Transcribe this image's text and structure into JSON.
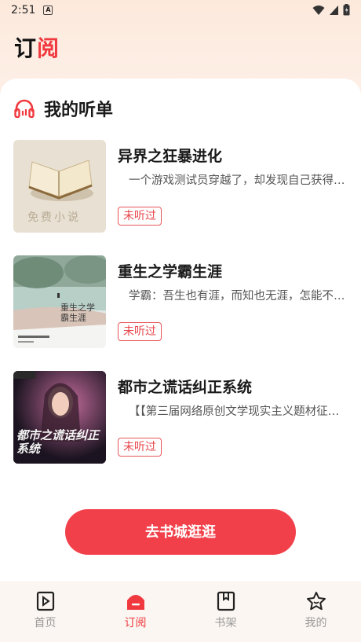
{
  "status_bar": {
    "time": "2:51",
    "notif_icon_letter": "A"
  },
  "page_title": {
    "part1": "订",
    "part2": "阅"
  },
  "section": {
    "title": "我的听单",
    "icon": "headphones-icon"
  },
  "books": [
    {
      "title": "异界之狂暴进化",
      "desc": "一个游戏测试员穿越了，却发现自己获得…",
      "badge": "未听过",
      "cover_text": "免费小说"
    },
    {
      "title": "重生之学霸生涯",
      "desc": "学霸：吾生也有涯，而知也无涯，怎能不…",
      "badge": "未听过",
      "cover_text": "重生之学霸生涯"
    },
    {
      "title": "都市之谎话纠正系统",
      "desc": "【【第三届网络原创文学现实主义题材征…",
      "badge": "未听过",
      "cover_text": "都市之谎话纠正系统"
    }
  ],
  "cta_button": "去书城逛逛",
  "tabs": [
    {
      "label": "首页",
      "icon": "play-book-icon"
    },
    {
      "label": "订阅",
      "icon": "subscribe-icon"
    },
    {
      "label": "书架",
      "icon": "bookshelf-icon"
    },
    {
      "label": "我的",
      "icon": "star-face-icon"
    }
  ],
  "colors": {
    "accent": "#f0393e",
    "inactive": "#9a9a9a"
  }
}
